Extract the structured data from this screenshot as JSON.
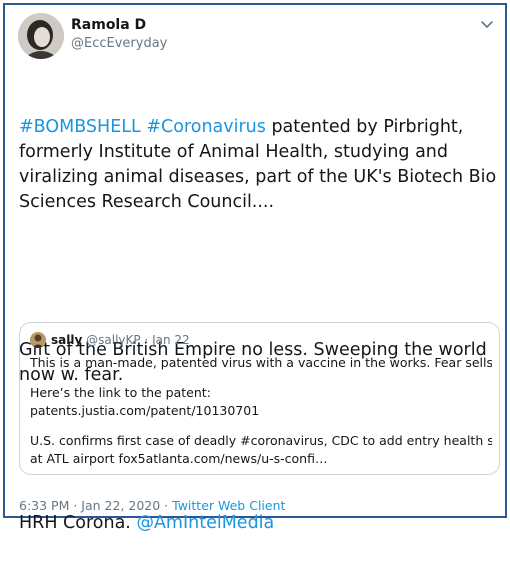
{
  "author": {
    "name": "Ramola D",
    "handle": "@EccEveryday"
  },
  "tweet": {
    "p1_hashtag1": "#BOMBSHELL",
    "p1_hashtag2": "#Coronavirus",
    "p1_text": " patented by Pirbright, formerly Institute of Animal Health, studying and viralizing animal diseases, part of the UK's Biotech Bio Sciences Research Council....",
    "p2_text": "Gift of the British Empire no less. Sweeping the world now w. fear.",
    "p3_text": "HRH Corona. ",
    "p3_mention": "@AmIntelMedia"
  },
  "quote": {
    "name": "sally",
    "handle": "@sallyKP",
    "separator": " · ",
    "date": "Jan 22",
    "line1": "This is a man-made, patented virus with a vaccine in the works. Fear sells.",
    "line2": "Here’s the link to the patent:",
    "line3": "patents.justia.com/patent/10130701",
    "line4": "U.S. confirms first case of deadly #coronavirus, CDC to add entry health screening",
    "line5": "at ATL airport fox5atlanta.com/news/u-s-confi…"
  },
  "footer": {
    "time": "6:33 PM · Jan 22, 2020 · ",
    "client": "Twitter Web Client"
  },
  "colors": {
    "link": "#1b95e0",
    "frame_border": "#2b5797",
    "muted": "#657786"
  },
  "icons": {
    "caret": "chevron-down-icon",
    "avatar": "profile-photo",
    "quote_avatar": "profile-photo"
  }
}
